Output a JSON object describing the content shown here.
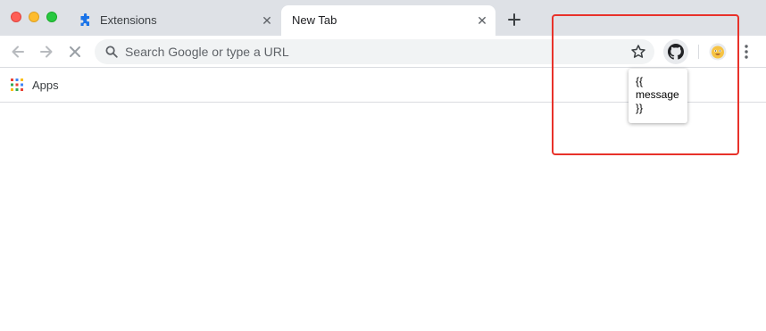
{
  "window": {
    "controls": [
      "close",
      "minimize",
      "zoom"
    ],
    "colors": {
      "close": "#fe5f57",
      "minimize": "#febc2e",
      "zoom": "#28c840"
    }
  },
  "tabs": [
    {
      "title": "Extensions",
      "icon": "puzzle-icon",
      "active": false
    },
    {
      "title": "New Tab",
      "active": true
    }
  ],
  "toolbar": {
    "omnibox_placeholder": "Search Google or type a URL",
    "extension_icon": "github-icon"
  },
  "bookmarks": {
    "apps_label": "Apps"
  },
  "popup": {
    "text": "{{ message }}"
  },
  "annotation": {
    "color": "#e8322a"
  }
}
